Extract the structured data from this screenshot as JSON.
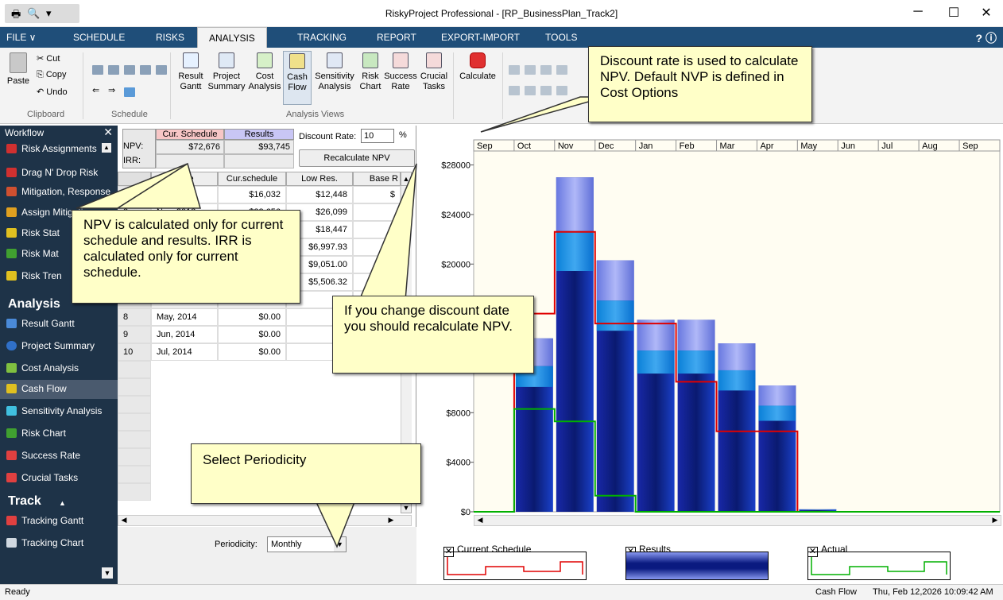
{
  "window": {
    "title": "RiskyProject Professional - [RP_BusinessPlan_Track2]"
  },
  "menu": [
    "FILE ∨",
    "SCHEDULE",
    "RISKS",
    "ANALYSIS",
    "TRACKING",
    "REPORT",
    "EXPORT-IMPORT",
    "TOOLS"
  ],
  "help": "? ⓘ",
  "ribbon": {
    "clipboard": {
      "paste": "Paste",
      "cut": "Cut",
      "copy": "Copy",
      "undo": "Undo",
      "label": "Clipboard"
    },
    "schedule": {
      "label": "Schedule"
    },
    "views": [
      {
        "l1": "Result",
        "l2": "Gantt"
      },
      {
        "l1": "Project",
        "l2": "Summary"
      },
      {
        "l1": "Cost",
        "l2": "Analysis"
      },
      {
        "l1": "Cash",
        "l2": "Flow"
      },
      {
        "l1": "Sensitivity",
        "l2": "Analysis"
      },
      {
        "l1": "Risk",
        "l2": "Chart"
      },
      {
        "l1": "Success",
        "l2": "Rate"
      },
      {
        "l1": "Crucial",
        "l2": "Tasks"
      }
    ],
    "views_label": "Analysis Views",
    "calculate": "Calculate"
  },
  "sidebar": {
    "header": "Workflow",
    "items_top": [
      "Risk Assignments",
      "Drag N' Drop Risk",
      "Mitigation, Response",
      "Assign Mitigation",
      "Risk Stat",
      "Risk Mat",
      "Risk Tren"
    ],
    "analysis_title": "Analysis",
    "analysis_items": [
      "Result Gantt",
      "Project Summary",
      "Cost Analysis",
      "Cash Flow",
      "Sensitivity Analysis",
      "Risk Chart",
      "Success Rate",
      "Crucial Tasks"
    ],
    "track_title": "Track",
    "track_items": [
      "Tracking Gantt",
      "Tracking Chart"
    ]
  },
  "npv_panel": {
    "col_cur": "Cur. Schedule",
    "col_results": "Results",
    "npv_label": "NPV:",
    "irr_label": "IRR:",
    "npv_cur": "$72,676",
    "npv_results": "$93,745",
    "discount_label": "Discount Rate:",
    "discount_value": "10",
    "percent": "%",
    "recalc": "Recalculate NPV"
  },
  "table": {
    "headers": [
      "Date",
      "Cur.schedule",
      "Low Res.",
      "Base R"
    ],
    "rows": [
      {
        "n": "1",
        "date": "Oct, 2013",
        "cur": "$16,032",
        "low": "$12,448",
        "base": "$"
      },
      {
        "n": "2",
        "date": "Nov, 2013",
        "cur": "$22,656",
        "low": "$26,099",
        "base": ""
      },
      {
        "n": "",
        "date": "",
        "cur": "",
        "low": "$18,447",
        "base": ""
      },
      {
        "n": "",
        "date": "",
        "cur": "",
        "low": "$6,997.93",
        "base": ""
      },
      {
        "n": "",
        "date": "",
        "cur": "",
        "low": "$9,051.00",
        "base": ""
      },
      {
        "n": "",
        "date": "",
        "cur": "",
        "low": "$5,506.32",
        "base": ""
      },
      {
        "n": "",
        "date": "",
        "cur": "",
        "low": "",
        "base": ""
      },
      {
        "n": "8",
        "date": "May, 2014",
        "cur": "$0.00",
        "low": "",
        "base": ""
      },
      {
        "n": "9",
        "date": "Jun, 2014",
        "cur": "$0.00",
        "low": "",
        "base": "$"
      },
      {
        "n": "10",
        "date": "Jul, 2014",
        "cur": "$0.00",
        "low": "",
        "base": "$"
      }
    ]
  },
  "periodicity": {
    "label": "Periodicity:",
    "value": "Monthly"
  },
  "chart_data": {
    "type": "bar",
    "months": [
      "Sep",
      "Oct",
      "Nov",
      "Dec",
      "Jan",
      "Feb",
      "Mar",
      "Apr",
      "May",
      "Jun",
      "Jul",
      "Aug",
      "Sep"
    ],
    "y_ticks": [
      "$28000",
      "$24000",
      "$20000",
      "$8000",
      "$4000",
      "$0"
    ],
    "ylim": [
      0,
      29000
    ],
    "series": [
      {
        "name": "Results",
        "values": [
          0,
          14000,
          27000,
          20300,
          15500,
          15500,
          13600,
          10200,
          200,
          0,
          0,
          0,
          0
        ]
      },
      {
        "name": "Current Schedule",
        "values": [
          0,
          16000,
          22600,
          15200,
          15200,
          10500,
          6500,
          6500,
          0,
          0,
          0,
          0,
          0
        ]
      },
      {
        "name": "Actual",
        "values": [
          0,
          8300,
          7300,
          1300,
          0,
          0,
          0,
          0,
          0,
          0,
          0,
          0,
          0
        ]
      }
    ],
    "colors": {
      "current": "#e00000",
      "results": "#1030b0",
      "actual": "#00b000"
    }
  },
  "legend": {
    "current": "Current Schedule",
    "results": "Results",
    "actual": "Actual",
    "checked": "✕"
  },
  "callouts": {
    "discount": "Discount rate is used to calculate NPV. Default NVP is defined in Cost Options",
    "npv": "NPV is calculated only for current schedule and results. IRR is calculated only for current schedule.",
    "recalc": "If you change discount date you should recalculate NPV.",
    "periodicity": "Select Periodicity"
  },
  "status": {
    "left": "Ready",
    "view": "Cash Flow",
    "datetime": "Thu, Feb 12,2026 10:09:42 AM"
  }
}
